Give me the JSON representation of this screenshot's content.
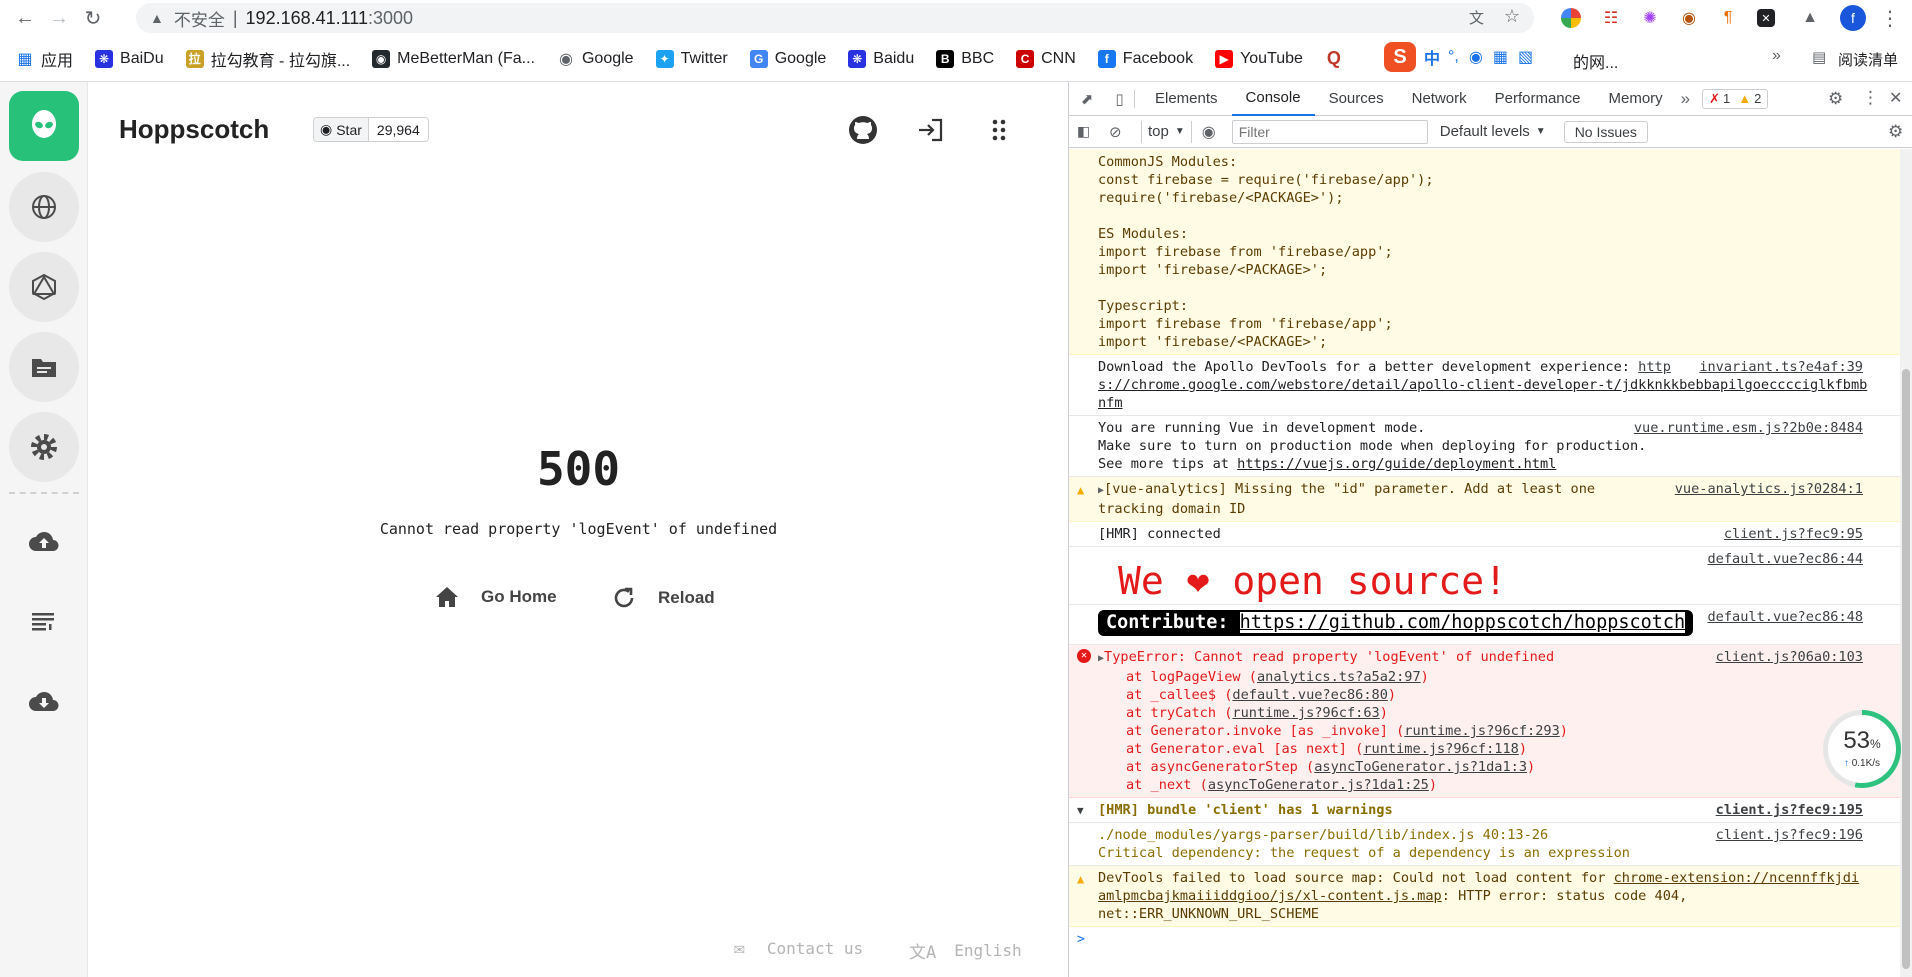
{
  "browser": {
    "address": {
      "insecure_label": "不安全",
      "separator": "|",
      "host": "192.168.41.111",
      "port": ":3000"
    },
    "bookmarks": [
      {
        "label": "应用",
        "icon": "apps-grid-icon"
      },
      {
        "label": "BaiDu",
        "icon": "baidu-paw-icon"
      },
      {
        "label": "拉勾教育 - 拉勾旗...",
        "icon": "lagou-icon"
      },
      {
        "label": "MeBetterMan (Fa...",
        "icon": "github-icon"
      },
      {
        "label": "Google",
        "icon": "globe-icon"
      },
      {
        "label": "Twitter",
        "icon": "twitter-icon"
      },
      {
        "label": "Google",
        "icon": "google-icon"
      },
      {
        "label": "Baidu",
        "icon": "baidu-paw-icon"
      },
      {
        "label": "BBC",
        "icon": "bbc-icon"
      },
      {
        "label": "CNN",
        "icon": "cnn-icon"
      },
      {
        "label": "Facebook",
        "icon": "facebook-icon"
      },
      {
        "label": "YouTube",
        "icon": "youtube-icon"
      }
    ],
    "bookmarks_overflow_tail": "的网...",
    "reading_list": "阅读清单",
    "ime": {
      "lang": "中",
      "punct": "°,"
    },
    "profile_initial": "f"
  },
  "app": {
    "brand": "Hoppscotch",
    "star_label": "Star",
    "star_count": "29,964",
    "error_code": "500",
    "error_message": "Cannot read property 'logEvent' of undefined",
    "go_home": "Go Home",
    "reload": "Reload",
    "contact": "Contact us",
    "language": "English"
  },
  "devtools": {
    "tabs": [
      "Elements",
      "Console",
      "Sources",
      "Network",
      "Performance",
      "Memory"
    ],
    "more": "»",
    "error_count": "1",
    "warning_count": "2",
    "context": "top",
    "filter_placeholder": "Filter",
    "levels": "Default levels",
    "issues": "No Issues",
    "network_widget": {
      "percent": "53",
      "unit": "%",
      "rate": "0.1K/s"
    },
    "messages": {
      "firebase_block": "CommonJS Modules:\nconst firebase = require('firebase/app');\nrequire('firebase/<PACKAGE>');\n\nES Modules:\nimport firebase from 'firebase/app';\nimport 'firebase/<PACKAGE>';\n\nTypescript:\nimport firebase from 'firebase/app';\nimport 'firebase/<PACKAGE>';",
      "apollo_text": "Download the Apollo DevTools for a better development experience: ",
      "apollo_link_a": "http",
      "apollo_link_b": "s://chrome.google.com/webstore/detail/apollo-client-developer-t/jdkknkkbebbapilgoecccciglkfbmb",
      "apollo_link_c": "nfm",
      "apollo_src": "invariant.ts?e4af:39",
      "vue_text": "You are running Vue in development mode.\nMake sure to turn on production mode when deploying for production.\nSee more tips at ",
      "vue_link": "https://vuejs.org/guide/deployment.html",
      "vue_src": "vue.runtime.esm.js?2b0e:8484",
      "analytics_text": "[vue-analytics] Missing the \"id\" parameter. Add at least one\ntracking domain ID",
      "analytics_src": "vue-analytics.js?0284:1",
      "hmr_text": "[HMR] connected",
      "hmr_src": "client.js?fec9:95",
      "love_src": "default.vue?ec86:44",
      "love_a": "We ",
      "love_b": " open source!",
      "contribute_label": "Contribute: ",
      "contribute_link": "https://github.com/hoppscotch/hoppscotch",
      "contribute_src": "default.vue?ec86:48",
      "typeerror_text": "TypeError: Cannot read property 'logEvent' of undefined",
      "typeerror_src": "client.js?06a0:103",
      "stack": [
        {
          "fn": "at logPageView (",
          "loc": "analytics.ts?a5a2:97",
          "end": ")"
        },
        {
          "fn": "at _callee$ (",
          "loc": "default.vue?ec86:80",
          "end": ")"
        },
        {
          "fn": "at tryCatch (",
          "loc": "runtime.js?96cf:63",
          "end": ")"
        },
        {
          "fn": "at Generator.invoke [as _invoke] (",
          "loc": "runtime.js?96cf:293",
          "end": ")"
        },
        {
          "fn": "at Generator.eval [as next] (",
          "loc": "runtime.js?96cf:118",
          "end": ")"
        },
        {
          "fn": "at asyncGeneratorStep (",
          "loc": "asyncToGenerator.js?1da1:3",
          "end": ")"
        },
        {
          "fn": "at _next (",
          "loc": "asyncToGenerator.js?1da1:25",
          "end": ")"
        }
      ],
      "group_text": "[HMR] bundle 'client' has 1 warnings",
      "group_src": "client.js?fec9:195",
      "yargs_text": "./node_modules/yargs-parser/build/lib/index.js 40:13-26\nCritical dependency: the request of a dependency is an expression",
      "yargs_src": "client.js?fec9:196",
      "sourcemap_a": "DevTools failed to load source map: Could not load content for ",
      "sourcemap_link1": "chrome-extension://ncennffkjdi",
      "sourcemap_link2": "amlpmcbajkmaiiiddgioo/js/xl-content.js.map",
      "sourcemap_b": ": HTTP error: status code 404,",
      "sourcemap_c": "net::ERR_UNKNOWN_URL_SCHEME",
      "prompt": ">"
    }
  },
  "colors": {
    "brand_green": "#28c17a",
    "error_red": "#e41a1a",
    "warning_bg": "#fffbe5",
    "accent_blue": "#1a73e8"
  }
}
